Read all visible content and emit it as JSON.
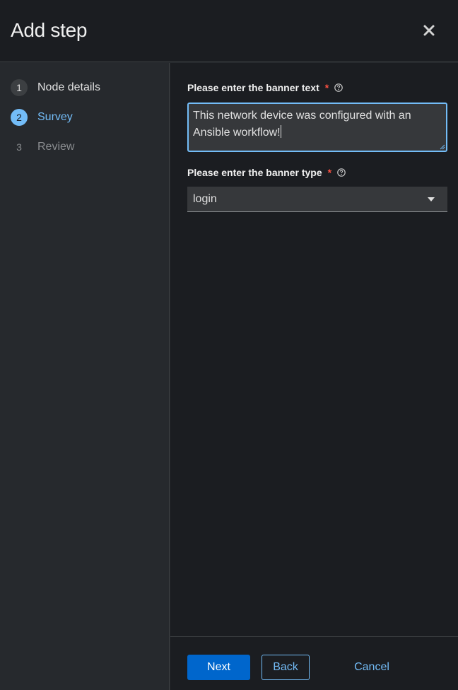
{
  "modal": {
    "title": "Add step"
  },
  "wizard_nav": {
    "steps": [
      {
        "number": "1",
        "label": "Node details",
        "state": "done"
      },
      {
        "number": "2",
        "label": "Survey",
        "state": "current"
      },
      {
        "number": "3",
        "label": "Review",
        "state": "future"
      }
    ]
  },
  "form": {
    "banner_text": {
      "label": "Please enter the banner text",
      "required_marker": "*",
      "line1": "This network device was configured with an",
      "line2": "Ansible workflow!"
    },
    "banner_type": {
      "label": "Please enter the banner type",
      "required_marker": "*",
      "selected": "login"
    }
  },
  "footer": {
    "next_label": "Next",
    "back_label": "Back",
    "cancel_label": "Cancel"
  },
  "colors": {
    "accent": "#73bcf7",
    "primary_button": "#0066cc",
    "required": "#fe5142",
    "background": "#1b1d21"
  },
  "icons": {
    "close": "close-icon",
    "help": "help-icon",
    "dropdown": "caret-down-icon"
  }
}
